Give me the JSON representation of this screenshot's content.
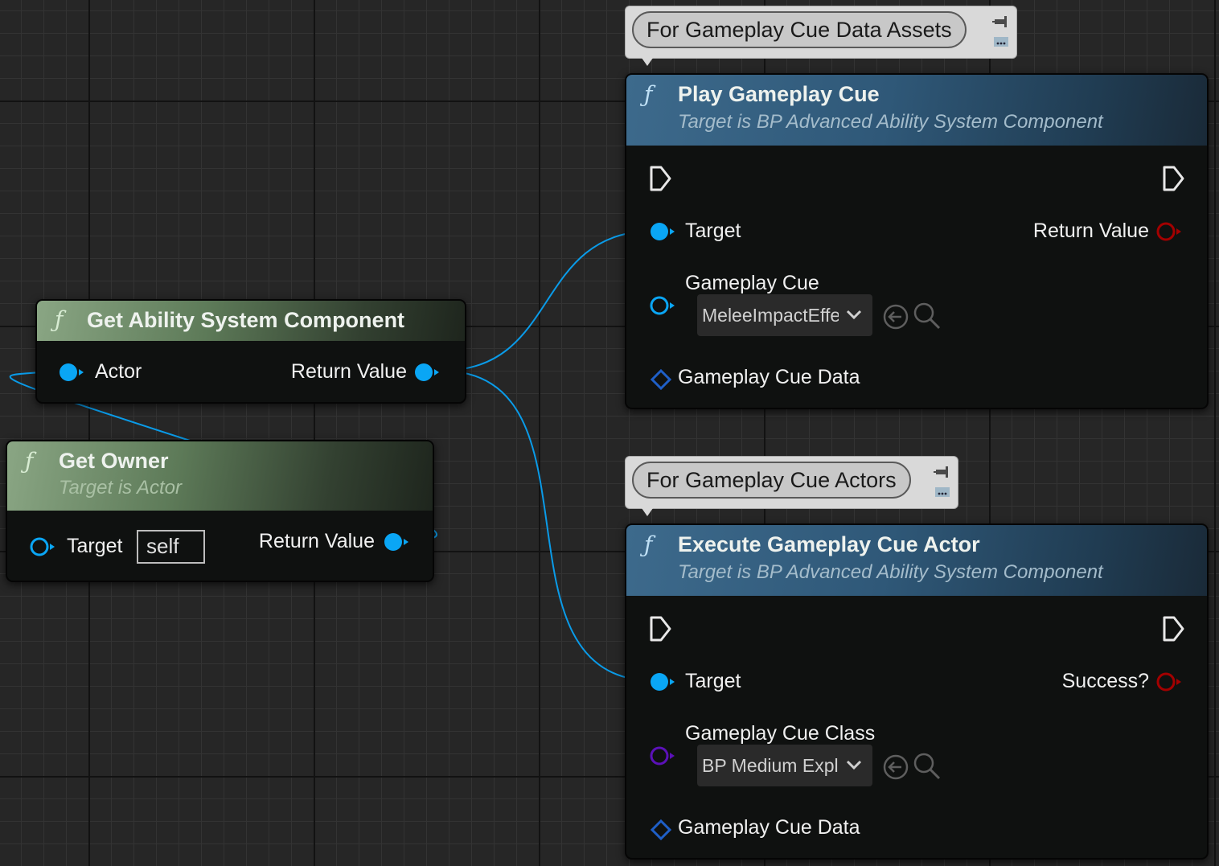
{
  "comments": {
    "data_assets": "For Gameplay Cue Data Assets",
    "actors": "For Gameplay Cue Actors"
  },
  "get_asc": {
    "title": "Get Ability System Component",
    "pin_actor": "Actor",
    "pin_return": "Return Value"
  },
  "get_owner": {
    "title": "Get Owner",
    "subtitle": "Target is Actor",
    "pin_target": "Target",
    "target_default": "self",
    "pin_return": "Return Value"
  },
  "play_cue": {
    "title": "Play Gameplay Cue",
    "subtitle": "Target is BP Advanced Ability System Component",
    "pin_target": "Target",
    "pin_return": "Return Value",
    "pin_cue": "Gameplay Cue",
    "cue_value": "MeleeImpactEffe",
    "pin_cue_data": "Gameplay Cue Data"
  },
  "exec_cue": {
    "title": "Execute Gameplay Cue Actor",
    "subtitle": "Target is BP Advanced Ability System Component",
    "pin_target": "Target",
    "pin_success": "Success?",
    "pin_cue_class": "Gameplay Cue Class",
    "cue_class_value": "BP Medium Expl",
    "pin_cue_data": "Gameplay Cue Data"
  },
  "colors": {
    "object_pin": "#0aa6f5",
    "bool_pin": "#a30000",
    "class_pin": "#5b11b8",
    "struct_pin": "#1f5fc7",
    "wire": "#0a9be8",
    "green_header": "#5d7a58",
    "blue_header": "#2f5878"
  }
}
